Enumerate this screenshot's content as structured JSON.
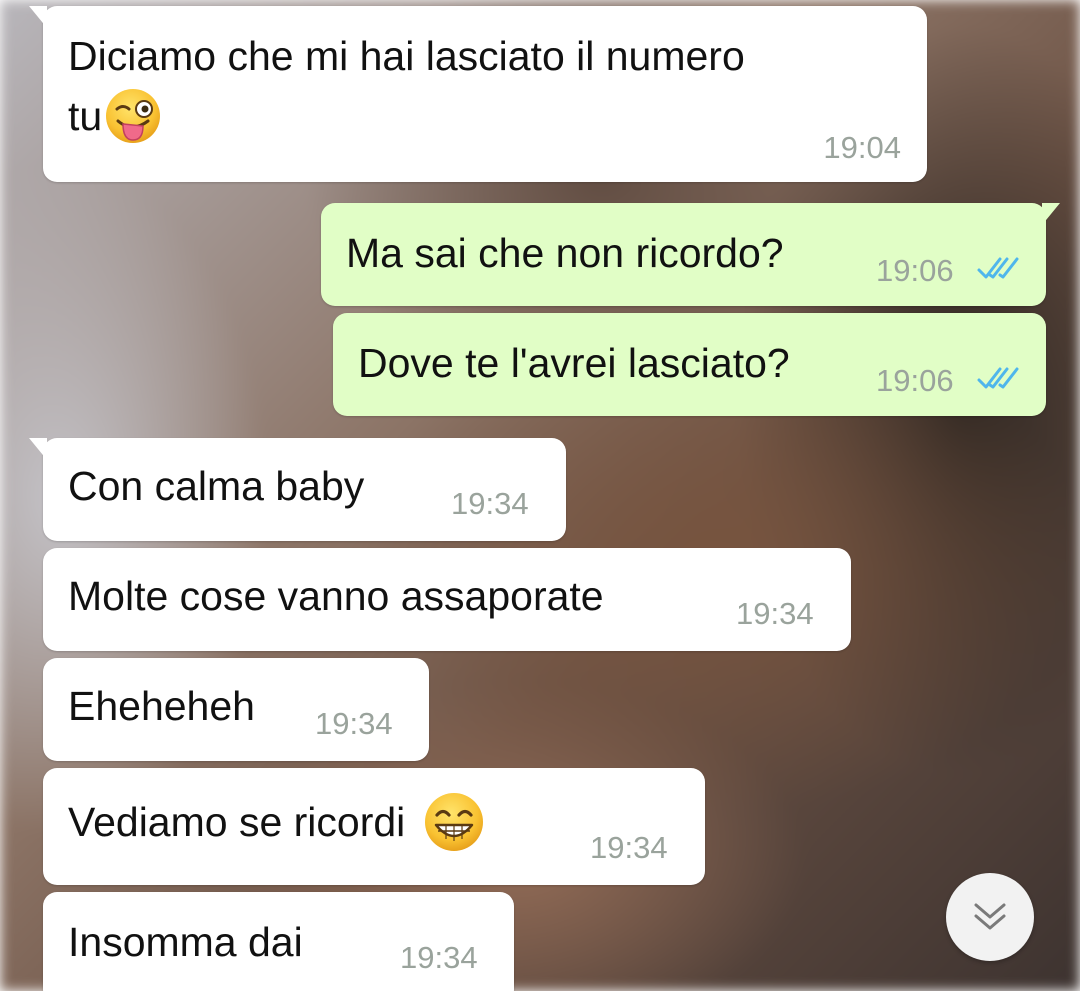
{
  "colors": {
    "incoming_bubble": "#ffffff",
    "outgoing_bubble": "#e1fec6",
    "timestamp": "#9aa39c",
    "read_ticks": "#4fb6ec"
  },
  "messages": [
    {
      "direction": "incoming",
      "line1": "Diciamo che mi hai lasciato il numero",
      "line2": "tu",
      "emoji": "winking-face-with-tongue",
      "time": "19:04"
    },
    {
      "direction": "outgoing",
      "text": "Ma sai che non ricordo?",
      "time": "19:06",
      "status": "read"
    },
    {
      "direction": "outgoing",
      "text": "Dove te l'avrei lasciato?",
      "time": "19:06",
      "status": "read"
    },
    {
      "direction": "incoming",
      "text": "Con calma baby",
      "time": "19:34"
    },
    {
      "direction": "incoming",
      "text": "Molte cose vanno assaporate",
      "time": "19:34"
    },
    {
      "direction": "incoming",
      "text": "Eheheheh",
      "time": "19:34"
    },
    {
      "direction": "incoming",
      "text": "Vediamo se ricordi",
      "emoji": "grinning-face-with-smiling-eyes",
      "time": "19:34"
    },
    {
      "direction": "incoming",
      "text": "Insomma dai",
      "time": "19:34"
    }
  ],
  "scroll_button": {
    "icon": "double-chevron-down-icon"
  }
}
